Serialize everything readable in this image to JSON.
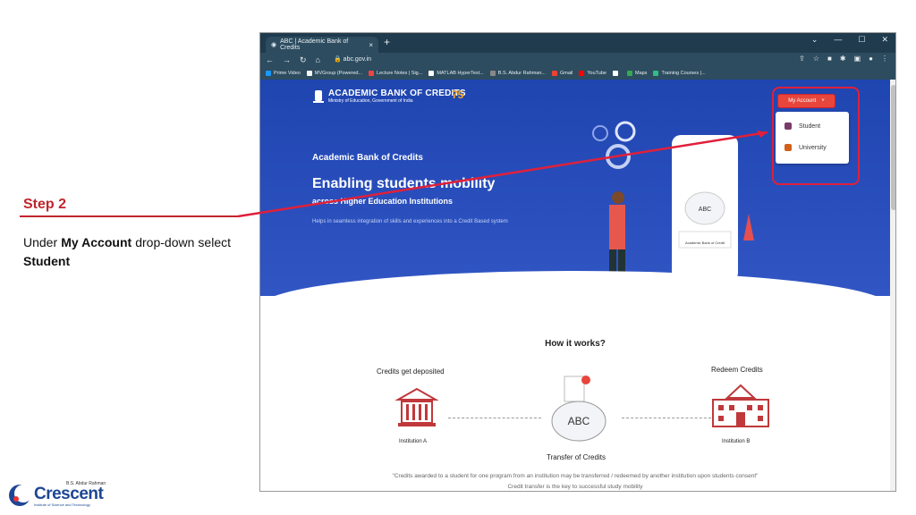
{
  "slide": {
    "step_title": "Step 2",
    "desc_prefix": "Under",
    "desc_bold1": "My Account",
    "desc_mid": "drop-down select",
    "desc_bold2": "Student"
  },
  "logo": {
    "top": "B.S. Abdur Rahman",
    "main": "Crescent",
    "sub": "Institute of Science and Technology"
  },
  "browser": {
    "tab_title": "ABC | Academic Bank of Credits",
    "tab_close": "×",
    "new_tab": "+",
    "url": "abc.gov.in",
    "bookmarks": [
      {
        "label": "Prime Video",
        "color": "#1a98ff"
      },
      {
        "label": "MVGroup (Powered...",
        "color": "#f5f5f5"
      },
      {
        "label": "Lecture Notes | Sig...",
        "color": "#e44"
      },
      {
        "label": "MATLAB HyperText...",
        "color": "#fff"
      },
      {
        "label": "B.S. Abdur Rahman...",
        "color": "#888"
      },
      {
        "label": "Gmail",
        "color": "#ea4335"
      },
      {
        "label": "YouTube",
        "color": "#ff0000"
      },
      {
        "label": "",
        "color": "#fff"
      },
      {
        "label": "Maps",
        "color": "#34a853"
      },
      {
        "label": "Training Courses |...",
        "color": "#3b8"
      }
    ]
  },
  "site": {
    "abc_name": "ACADEMIC BANK OF CREDITS",
    "ministry": "Ministry of Education, Government of India",
    "azadi": "75",
    "hero_label": "Academic Bank of Credits",
    "hero_title": "Enabling students mobility",
    "hero_sub": "across Higher Education Institutions",
    "hero_desc": "Helps in seamless integration of skills and experiences into a Credit Based system",
    "my_account": "My Account",
    "dropdown_student": "Student",
    "dropdown_university": "University",
    "how_title": "How it works?",
    "credits_deposited": "Credits get deposited",
    "redeem_credits": "Redeem Credits",
    "institution_a": "Institution A",
    "institution_b": "Institution B",
    "transfer": "Transfer of Credits",
    "piggy_label": "ABC",
    "card_label": "Academic Bank of Credit",
    "quote1": "\"Credits awarded to a student for one program from an institution may be transferred / redeemed by another institution upon students consent\"",
    "quote2": "Credit transfer is the key to successful study mobility"
  },
  "colors": {
    "accent_red": "#c0262d",
    "hero_blue": "#1f45b0",
    "button_red": "#e8453c"
  }
}
